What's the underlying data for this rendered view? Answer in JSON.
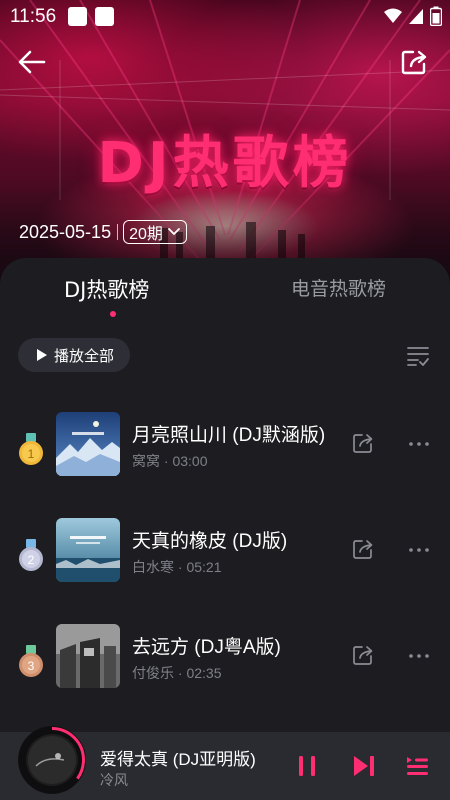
{
  "status_bar": {
    "time": "11:56"
  },
  "header": {
    "banner_title": "DJ热歌榜",
    "date": "2025-05-15",
    "period": "20期"
  },
  "tabs": [
    {
      "label": "DJ热歌榜",
      "active": true
    },
    {
      "label": "电音热歌榜",
      "active": false
    }
  ],
  "toolbar": {
    "play_all_label": "播放全部"
  },
  "songs": [
    {
      "rank": "1",
      "title": "月亮照山川 (DJ默涵版)",
      "artist": "窝窝",
      "duration": "03:00",
      "medal_color": "#f1b73a"
    },
    {
      "rank": "2",
      "title": "天真的橡皮 (DJ版)",
      "artist": "白水寒",
      "duration": "05:21",
      "medal_color": "#b9bdd6"
    },
    {
      "rank": "3",
      "title": "去远方 (DJ粤A版)",
      "artist": "付俊乐",
      "duration": "02:35",
      "medal_color": "#d89a78"
    }
  ],
  "player": {
    "title": "爱得太真 (DJ亚明版)",
    "artist": "冷风",
    "progress": 0.35
  },
  "colors": {
    "accent": "#ff2d72",
    "background": "#1c1c21",
    "player_bg": "#2a2b31"
  }
}
